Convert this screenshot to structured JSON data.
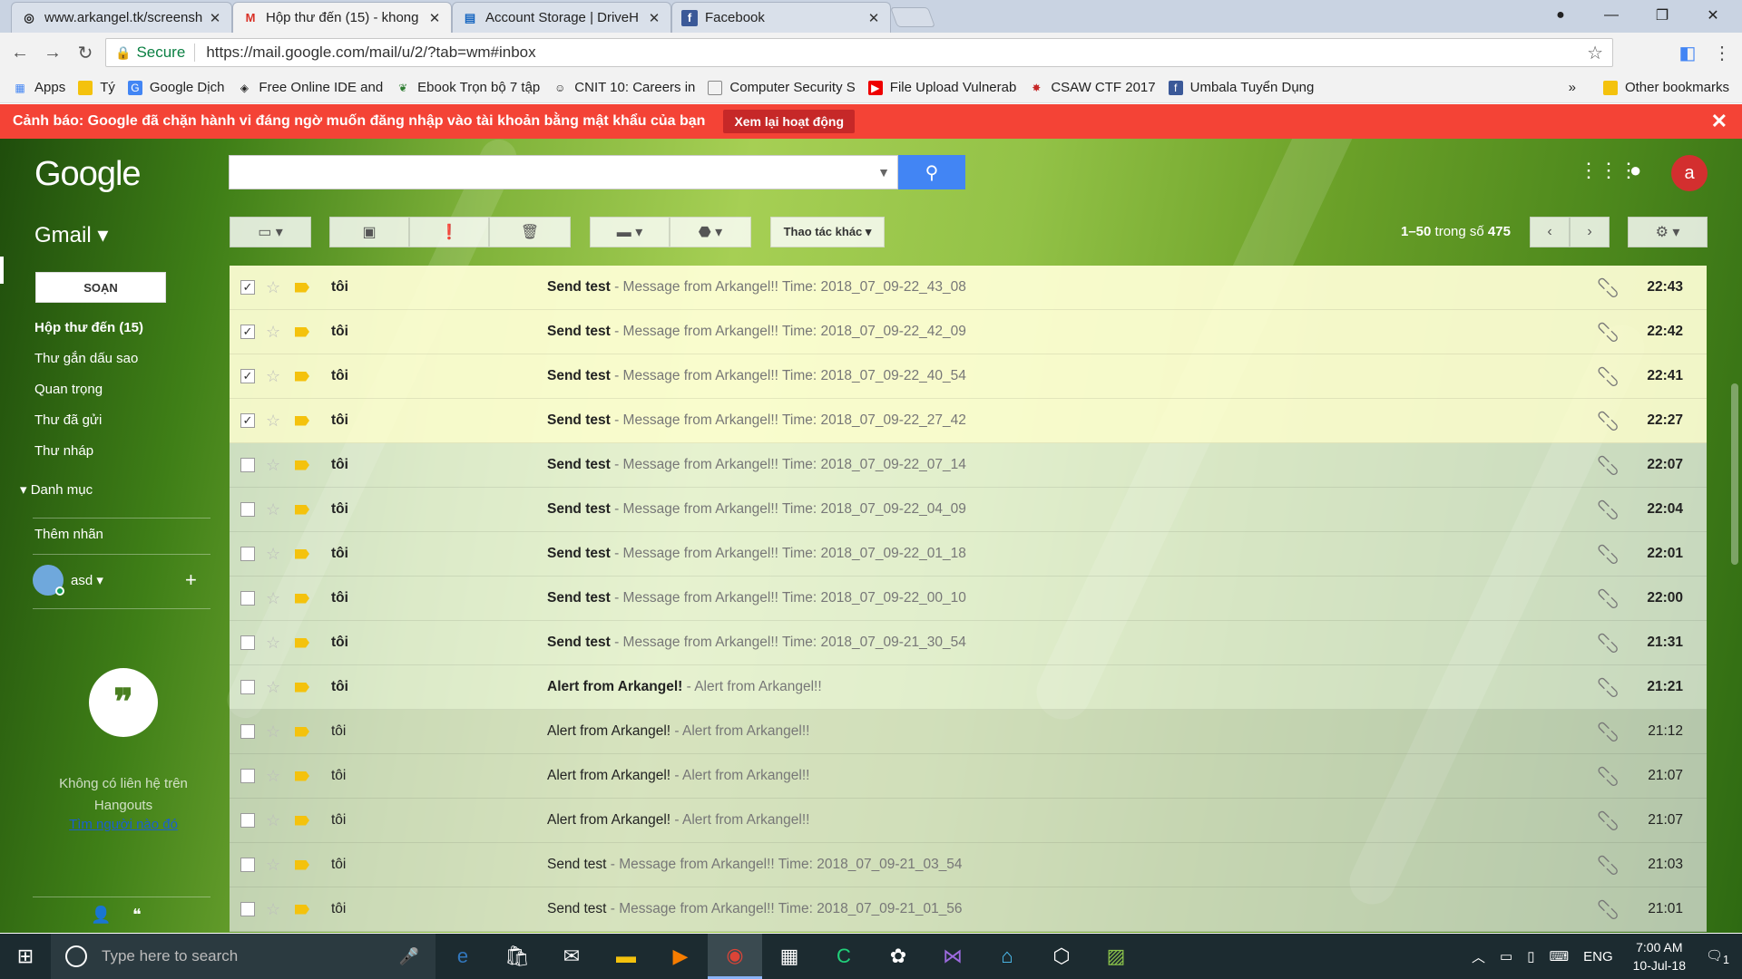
{
  "browser": {
    "tabs": [
      {
        "title": "www.arkangel.tk/screensh",
        "icon": "site-icon"
      },
      {
        "title": "Hộp thư đến (15) - khong",
        "icon": "gmail-icon"
      },
      {
        "title": "Account Storage | DriveH",
        "icon": "drive-icon"
      },
      {
        "title": "Facebook",
        "icon": "facebook-icon"
      }
    ],
    "active_tab": 1,
    "secure_label": "Secure",
    "url": "https://mail.google.com/mail/u/2/?tab=wm#inbox",
    "bookmarks": [
      {
        "label": "Apps",
        "icon": "apps-grid-icon"
      },
      {
        "label": "Tý",
        "icon": "folder-icon"
      },
      {
        "label": "Google Dịch",
        "icon": "google-translate-icon"
      },
      {
        "label": "Free Online IDE and",
        "icon": "ide-icon"
      },
      {
        "label": "Ebook Trọn bộ 7 tập",
        "icon": "ebook-icon"
      },
      {
        "label": "CNIT 10: Careers in",
        "icon": "cnit-icon"
      },
      {
        "label": "Computer Security S",
        "icon": "page-icon"
      },
      {
        "label": "File Upload Vulnerab",
        "icon": "youtube-icon"
      },
      {
        "label": "CSAW CTF 2017",
        "icon": "csaw-icon"
      },
      {
        "label": "Umbala Tuyển Dụng",
        "icon": "facebook-icon"
      }
    ],
    "other_bookmarks": "Other bookmarks",
    "overflow": "»"
  },
  "warning": {
    "text": "Cảnh báo: Google đã chặn hành vi đáng ngờ muốn đăng nhập vào tài khoản bằng mật khẩu của bạn",
    "button": "Xem lại hoạt động"
  },
  "gmail": {
    "logo": "Google",
    "label": "Gmail ▾",
    "more_actions": "Thao tác khác ▾",
    "pager": {
      "range": "1–50",
      "of": "trong số",
      "total": "475"
    },
    "compose": "SOẠN",
    "nav": [
      {
        "label": "Hộp thư đến (15)"
      },
      {
        "label": "Thư gắn dấu sao"
      },
      {
        "label": "Quan trọng"
      },
      {
        "label": "Thư đã gửi"
      },
      {
        "label": "Thư nháp"
      }
    ],
    "categories": "Danh mục",
    "add_label": "Thêm nhãn",
    "user": "asd",
    "hangouts_text": "Không có liên hệ trên Hangouts",
    "hangouts_link": "Tìm người nào đó",
    "avatar_letter": "a"
  },
  "emails": [
    {
      "state": "sel",
      "checked": "✓",
      "from": "tôi",
      "subject": "Send test",
      "snippet": " - Message from Arkangel!! Time: 2018_07_09-22_43_08",
      "time": "22:43"
    },
    {
      "state": "sel",
      "checked": "✓",
      "from": "tôi",
      "subject": "Send test",
      "snippet": " - Message from Arkangel!! Time: 2018_07_09-22_42_09",
      "time": "22:42"
    },
    {
      "state": "sel",
      "checked": "✓",
      "from": "tôi",
      "subject": "Send test",
      "snippet": " - Message from Arkangel!! Time: 2018_07_09-22_40_54",
      "time": "22:41"
    },
    {
      "state": "sel",
      "checked": "✓",
      "from": "tôi",
      "subject": "Send test",
      "snippet": " - Message from Arkangel!! Time: 2018_07_09-22_27_42",
      "time": "22:27"
    },
    {
      "state": "unread",
      "checked": "",
      "from": "tôi",
      "subject": "Send test",
      "snippet": " - Message from Arkangel!! Time: 2018_07_09-22_07_14",
      "time": "22:07"
    },
    {
      "state": "unread",
      "checked": "",
      "from": "tôi",
      "subject": "Send test",
      "snippet": " - Message from Arkangel!! Time: 2018_07_09-22_04_09",
      "time": "22:04"
    },
    {
      "state": "unread",
      "checked": "",
      "from": "tôi",
      "subject": "Send test",
      "snippet": " - Message from Arkangel!! Time: 2018_07_09-22_01_18",
      "time": "22:01"
    },
    {
      "state": "unread",
      "checked": "",
      "from": "tôi",
      "subject": "Send test",
      "snippet": " - Message from Arkangel!! Time: 2018_07_09-22_00_10",
      "time": "22:00"
    },
    {
      "state": "unread",
      "checked": "",
      "from": "tôi",
      "subject": "Send test",
      "snippet": " - Message from Arkangel!! Time: 2018_07_09-21_30_54",
      "time": "21:31"
    },
    {
      "state": "unread",
      "checked": "",
      "from": "tôi",
      "subject": "Alert from Arkangel!",
      "snippet": " - Alert from Arkangel!!",
      "time": "21:21"
    },
    {
      "state": "read",
      "checked": "",
      "from": "tôi",
      "subject": "Alert from Arkangel!",
      "snippet": " - Alert from Arkangel!!",
      "time": "21:12"
    },
    {
      "state": "read",
      "checked": "",
      "from": "tôi",
      "subject": "Alert from Arkangel!",
      "snippet": " - Alert from Arkangel!!",
      "time": "21:07"
    },
    {
      "state": "read",
      "checked": "",
      "from": "tôi",
      "subject": "Alert from Arkangel!",
      "snippet": " - Alert from Arkangel!!",
      "time": "21:07"
    },
    {
      "state": "read",
      "checked": "",
      "from": "tôi",
      "subject": "Send test",
      "snippet": " - Message from Arkangel!! Time: 2018_07_09-21_03_54",
      "time": "21:03"
    },
    {
      "state": "read",
      "checked": "",
      "from": "tôi",
      "subject": "Send test",
      "snippet": " - Message from Arkangel!! Time: 2018_07_09-21_01_56",
      "time": "21:01"
    }
  ],
  "taskbar": {
    "search_placeholder": "Type here to search",
    "language": "ENG",
    "time": "7:00 AM",
    "date": "10-Jul-18",
    "notification_count": "1"
  },
  "colors": {
    "warning": "#f44336",
    "search_button": "#4285f4",
    "avatar": "#d32f2f"
  }
}
